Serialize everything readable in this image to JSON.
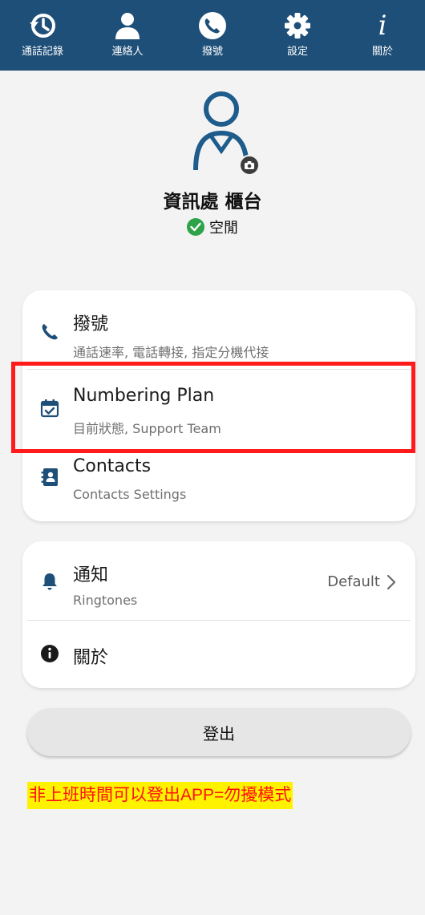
{
  "nav": {
    "items": [
      {
        "label": "通話記錄",
        "icon": "history-icon"
      },
      {
        "label": "連絡人",
        "icon": "person-icon"
      },
      {
        "label": "撥號",
        "icon": "phone-icon"
      },
      {
        "label": "設定",
        "icon": "gear-icon"
      },
      {
        "label": "關於",
        "icon": "info-italic-icon",
        "glyph": "i"
      }
    ],
    "active_index": 3
  },
  "profile": {
    "name": "資訊處 櫃台",
    "status": "空閒",
    "status_color": "#2fa34a"
  },
  "settings": {
    "card1": [
      {
        "title": "撥號",
        "subtitle": "通話速率, 電話轉接, 指定分機代接",
        "icon": "phone-icon"
      },
      {
        "title": "Numbering Plan",
        "subtitle": "目前狀態, Support Team",
        "icon": "calendar-check-icon"
      },
      {
        "title": "Contacts",
        "subtitle": "Contacts Settings",
        "icon": "contact-book-icon"
      }
    ],
    "card2": [
      {
        "title": "通知",
        "subtitle": "Ringtones",
        "value": "Default",
        "icon": "bell-icon"
      },
      {
        "title": "關於",
        "icon": "info-icon"
      }
    ]
  },
  "logout_label": "登出",
  "annotation_note": "非上班時間可以登出APP=勿擾模式",
  "colors": {
    "nav_bg": "#1e4f78",
    "accent_blue": "#1e4f78",
    "highlight_red": "#ff1b1b",
    "note_bg": "#fff200",
    "note_text": "#ff1111"
  }
}
